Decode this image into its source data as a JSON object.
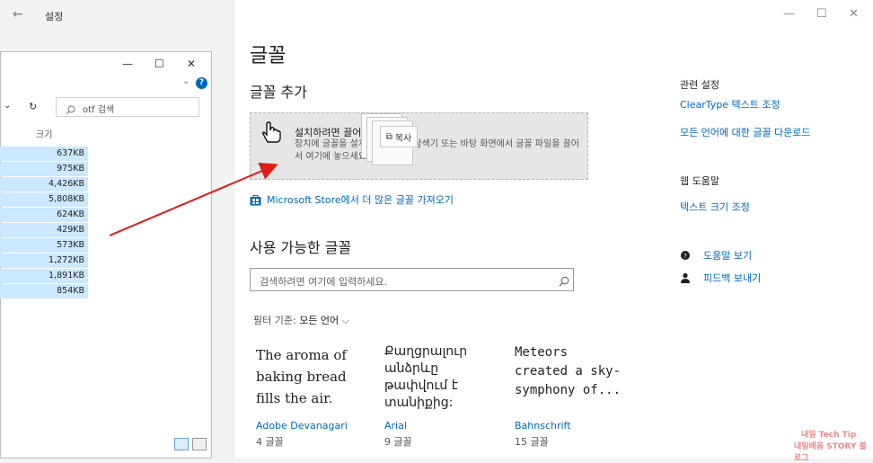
{
  "window": {
    "back_glyph": "←",
    "app_title": "설정",
    "min": "—",
    "max": "☐",
    "close": "✕"
  },
  "page": {
    "title": "글꼴",
    "add_font_title": "글꼴 추가",
    "drop_zone": {
      "title": "설치하려면 끌어",
      "description": "장치에 글꼴을 설치하려면 파일 탐색기 또는 바탕 화면에서 글꼴 파일을 끌어서 여기에 놓으세요."
    },
    "copy_tip": "복사",
    "store_link": "Microsoft Store에서 더 많은 글꼴 가져오기",
    "available_title": "사용 가능한 글꼴",
    "search_placeholder": "검색하려면 여기에 입력하세요.",
    "filter_label": "필터 기준:",
    "filter_value": "모든 언어",
    "fonts": [
      {
        "sample": "The aroma of baking bread fills the air.",
        "name": "Adobe Devanagari",
        "count": "4 글꼴"
      },
      {
        "sample": "Քաղցրալուր անձրևը թափվում է տանիքից:",
        "name": "Arial",
        "count": "9 글꼴"
      },
      {
        "sample": "Meteors created a sky-symphony of...",
        "name": "Bahnschrift",
        "count": "15 글꼴"
      }
    ]
  },
  "right": {
    "related_head": "관련 설정",
    "related_links": [
      "ClearType 텍스트 조정",
      "모든 언어에 대한 글꼴 다운로드"
    ],
    "help_head": "웹 도움말",
    "help_links": [
      "텍스트 크기 조정"
    ],
    "support_links": [
      "도움말 보기",
      "피드백 보내기"
    ]
  },
  "explorer": {
    "min": "—",
    "max": "☐",
    "close": "✕",
    "search_placeholder": "otf 검색",
    "refresh": "↻",
    "dropdown": "⌄",
    "column_size": "크기",
    "sizes": [
      "637KB",
      "975KB",
      "4,426KB",
      "5,808KB",
      "624KB",
      "429KB",
      "573KB",
      "1,272KB",
      "1,891KB",
      "854KB"
    ]
  },
  "watermark": {
    "line1": "내일 Tech Tip",
    "line2": "내일배움 STORY 블로그"
  },
  "colors": {
    "accent": "#0067c0",
    "selection": "#cce8ff",
    "arrow": "#e01b1b"
  }
}
